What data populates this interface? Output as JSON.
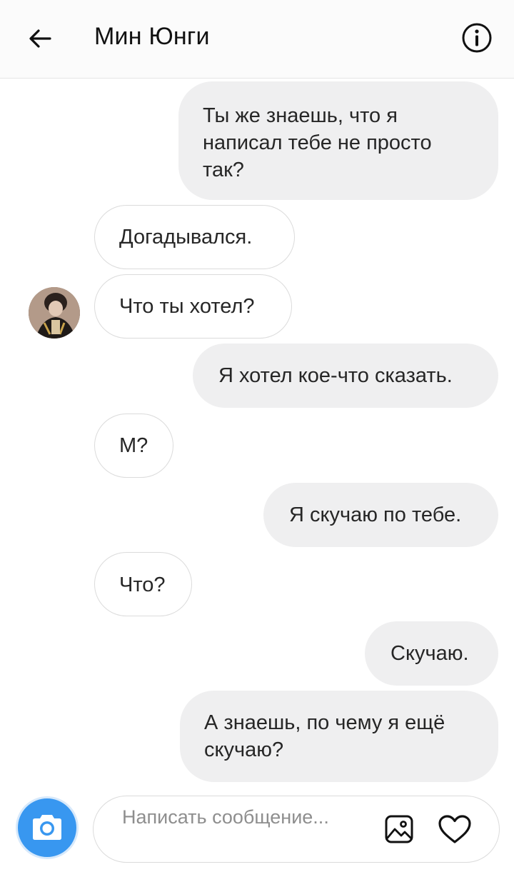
{
  "header": {
    "title": "Мин Юнги",
    "back_icon": "arrow-left-icon",
    "info_icon": "info-icon"
  },
  "messages": [
    {
      "direction": "out",
      "text": "Ты же знаешь, что я написал тебе не просто так?"
    },
    {
      "direction": "in",
      "text": "Догадывался."
    },
    {
      "direction": "in",
      "text": "Что ты хотел?"
    },
    {
      "direction": "out",
      "text": "Я хотел кое-что сказать."
    },
    {
      "direction": "in",
      "text": "М?"
    },
    {
      "direction": "out",
      "text": "Я скучаю по тебе."
    },
    {
      "direction": "in",
      "text": "Что?"
    },
    {
      "direction": "out",
      "text": "Скучаю."
    },
    {
      "direction": "out",
      "text": "А знаешь, по чему я ещё скучаю?"
    }
  ],
  "composer": {
    "placeholder": "Написать сообщение...",
    "camera_icon": "camera-icon",
    "gallery_icon": "image-icon",
    "like_icon": "heart-icon"
  },
  "colors": {
    "outgoing_bubble": "#efeff0",
    "incoming_border": "#dbdbdb",
    "camera_button": "#3897f0"
  }
}
